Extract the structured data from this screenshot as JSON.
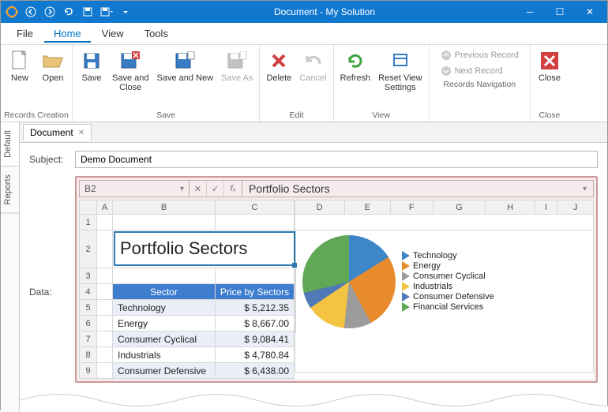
{
  "window": {
    "title": "Document - My Solution"
  },
  "menubar": {
    "items": [
      "File",
      "Home",
      "View",
      "Tools"
    ],
    "active": "Home"
  },
  "ribbon": {
    "groups": {
      "records_creation": {
        "label": "Records Creation",
        "new": "New",
        "open": "Open"
      },
      "save": {
        "label": "Save",
        "save": "Save",
        "save_close": "Save and\nClose",
        "save_new": "Save and New",
        "save_as": "Save As"
      },
      "edit": {
        "label": "Edit",
        "delete": "Delete",
        "cancel": "Cancel"
      },
      "view": {
        "label": "View",
        "refresh": "Refresh",
        "reset": "Reset View\nSettings"
      },
      "nav": {
        "label": "Records Navigation",
        "prev": "Previous Record",
        "next": "Next Record"
      },
      "close": {
        "label": "Close",
        "close": "Close"
      }
    }
  },
  "side_tabs": {
    "items": [
      "Default",
      "Reports"
    ],
    "active": "Default"
  },
  "doc_tab": {
    "label": "Document"
  },
  "form": {
    "subject_label": "Subject:",
    "subject_value": "Demo Document",
    "data_label": "Data:"
  },
  "formula_bar": {
    "name_box": "B2",
    "formula": "Portfolio Sectors"
  },
  "sheet": {
    "columns": [
      "A",
      "B",
      "C",
      "D",
      "E",
      "F",
      "G",
      "H",
      "I",
      "J"
    ],
    "title_cell": "Portfolio Sectors",
    "table_header": {
      "sector": "Sector",
      "price": "Price by Sectors"
    },
    "rows": [
      {
        "n": 5,
        "sector": "Technology",
        "price": "$ 5,212.35"
      },
      {
        "n": 6,
        "sector": "Energy",
        "price": "$ 8,667.00"
      },
      {
        "n": 7,
        "sector": "Consumer Cyclical",
        "price": "$ 9,084.41"
      },
      {
        "n": 8,
        "sector": "Industrials",
        "price": "$ 4,780.84"
      },
      {
        "n": 9,
        "sector": "Consumer Defensive",
        "price": "$ 6,438.00"
      }
    ]
  },
  "chart_data": {
    "type": "pie",
    "title": "",
    "series": [
      {
        "name": "Technology",
        "value": 5212.35,
        "color": "#3e86c8"
      },
      {
        "name": "Energy",
        "value": 8667.0,
        "color": "#e88b2d"
      },
      {
        "name": "Consumer Cyclical",
        "value": 9084.41,
        "color": "#9b9b9b"
      },
      {
        "name": "Industrials",
        "value": 4780.84,
        "color": "#f5c342"
      },
      {
        "name": "Consumer Defensive",
        "value": 6438.0,
        "color": "#4f79b7"
      },
      {
        "name": "Financial Services",
        "value": 10000.0,
        "color": "#60a756"
      }
    ]
  }
}
